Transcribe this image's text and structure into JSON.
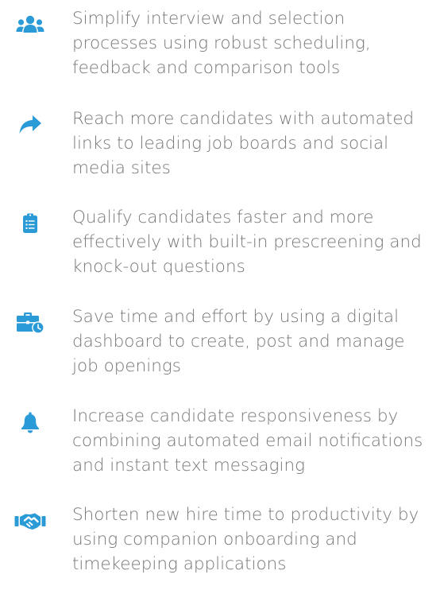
{
  "accent_color": "#2b9bd7",
  "text_color": "#777777",
  "features": [
    {
      "icon": "users-icon",
      "text": "Simplify interview and selection processes using robust scheduling, feedback and comparison tools"
    },
    {
      "icon": "share-arrow-icon",
      "text": "Reach more candidates with automated links to leading job boards and social media sites"
    },
    {
      "icon": "clipboard-list-icon",
      "text": "Qualify candidates faster and more effectively with built-in prescreening and knock-out questions"
    },
    {
      "icon": "briefcase-clock-icon",
      "text": "Save time and effort by using a digital dashboard to create, post and manage job openings"
    },
    {
      "icon": "bell-icon",
      "text": "Increase candidate responsiveness by combining automated email notifications and instant text messaging"
    },
    {
      "icon": "handshake-icon",
      "text": "Shorten new hire time to productivity by using companion onboarding and timekeeping applications"
    }
  ]
}
